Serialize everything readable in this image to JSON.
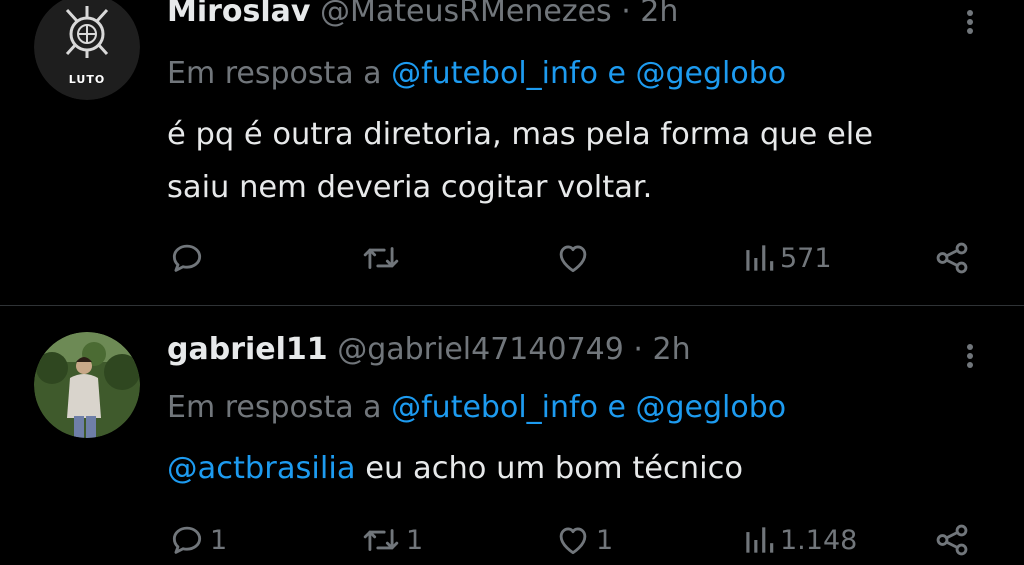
{
  "tweets": [
    {
      "author": "Miroslav",
      "handle": "@MateusRMenezes",
      "separator": "·",
      "time": "2h",
      "avatar_badge": "LUTO",
      "reply_prefix": "Em resposta a",
      "reply_mention_1": "@futebol_info",
      "reply_joiner": "e",
      "reply_mention_2": "@geglobo",
      "body_line_1": "é pq é outra diretoria, mas pela forma que ele",
      "body_line_2": "saiu nem deveria cogitar voltar.",
      "stats": {
        "replies": "",
        "reposts": "",
        "likes": "",
        "views": "571"
      }
    },
    {
      "author": "gabriel11",
      "handle": "@gabriel47140749",
      "separator": "·",
      "time": "2h",
      "reply_prefix": "Em resposta a",
      "reply_mention_1": "@futebol_info",
      "reply_joiner": "e",
      "reply_mention_2": "@geglobo",
      "body_mention": "@actbrasilia",
      "body_text": "eu acho um bom técnico",
      "stats": {
        "replies": "1",
        "reposts": "1",
        "likes": "1",
        "views": "1.148"
      }
    }
  ],
  "icons": {
    "reply": "reply-icon",
    "repost": "repost-icon",
    "like": "heart-icon",
    "views": "views-icon",
    "share": "share-icon",
    "more": "more-icon"
  },
  "colors": {
    "background": "#000000",
    "text": "#e7e9ea",
    "muted": "#71767b",
    "link": "#1d9bf0",
    "divider": "#2f3336"
  }
}
